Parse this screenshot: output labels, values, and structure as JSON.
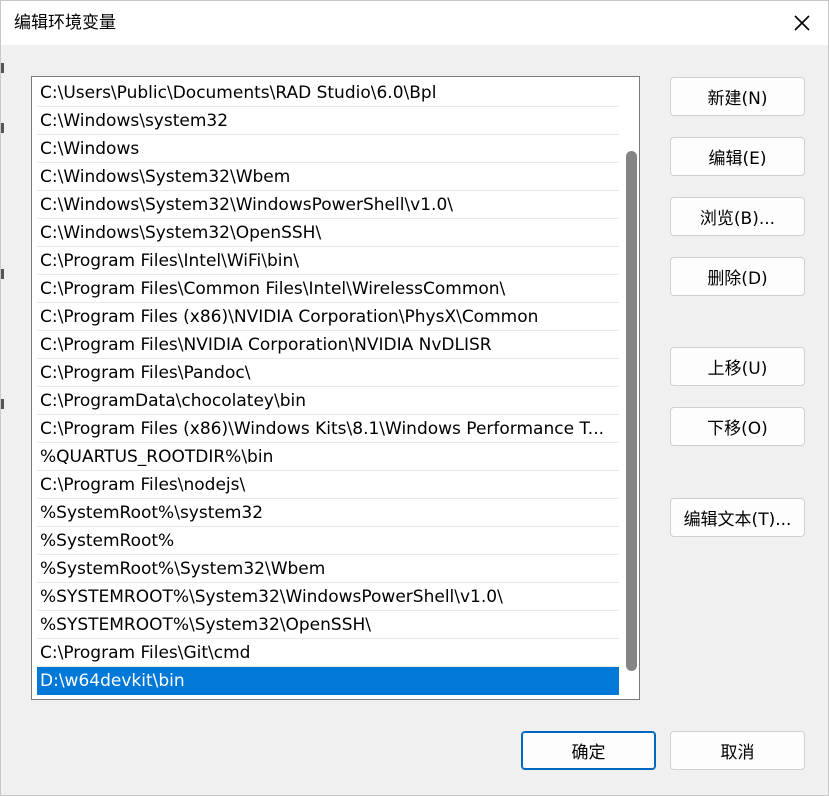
{
  "dialog": {
    "title": "编辑环境变量",
    "close_icon": "close-icon"
  },
  "path_list": {
    "items": [
      "C:\\Users\\Public\\Documents\\RAD Studio\\6.0\\Bpl",
      "C:\\Windows\\system32",
      "C:\\Windows",
      "C:\\Windows\\System32\\Wbem",
      "C:\\Windows\\System32\\WindowsPowerShell\\v1.0\\",
      "C:\\Windows\\System32\\OpenSSH\\",
      "C:\\Program Files\\Intel\\WiFi\\bin\\",
      "C:\\Program Files\\Common Files\\Intel\\WirelessCommon\\",
      "C:\\Program Files (x86)\\NVIDIA Corporation\\PhysX\\Common",
      "C:\\Program Files\\NVIDIA Corporation\\NVIDIA NvDLISR",
      "C:\\Program Files\\Pandoc\\",
      "C:\\ProgramData\\chocolatey\\bin",
      "C:\\Program Files (x86)\\Windows Kits\\8.1\\Windows Performance T...",
      "%QUARTUS_ROOTDIR%\\bin",
      "C:\\Program Files\\nodejs\\",
      "%SystemRoot%\\system32",
      "%SystemRoot%",
      "%SystemRoot%\\System32\\Wbem",
      "%SYSTEMROOT%\\System32\\WindowsPowerShell\\v1.0\\",
      "%SYSTEMROOT%\\System32\\OpenSSH\\",
      "C:\\Program Files\\Git\\cmd",
      "D:\\w64devkit\\bin"
    ],
    "selected_index": 21
  },
  "buttons": {
    "new": "新建(N)",
    "edit": "编辑(E)",
    "browse": "浏览(B)...",
    "delete": "删除(D)",
    "move_up": "上移(U)",
    "move_down": "下移(O)",
    "edit_text": "编辑文本(T)...",
    "ok": "确定",
    "cancel": "取消"
  },
  "colors": {
    "selection": "#0078d7",
    "primary_border": "#0067c0"
  }
}
